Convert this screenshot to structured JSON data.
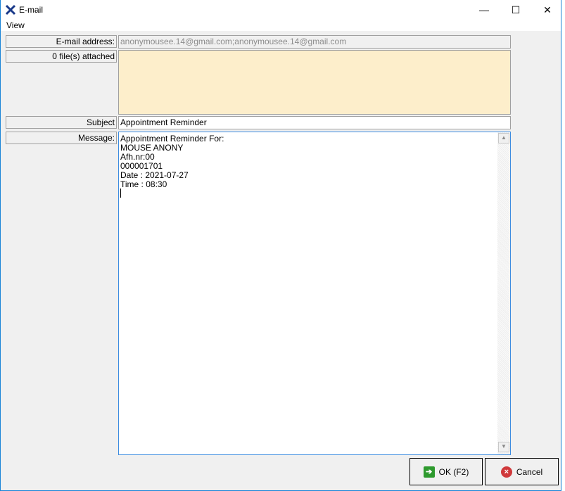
{
  "window": {
    "title": "E-mail",
    "minimize": "—",
    "maximize": "☐",
    "close": "✕"
  },
  "menu": {
    "view": "View"
  },
  "form": {
    "email_label": "E-mail address:",
    "email_value": "anonymousee.14@gmail.com;anonymousee.14@gmail.com",
    "attach_label": "0 file(s) attached",
    "subject_label": "Subject",
    "subject_value": "Appointment Reminder",
    "message_label": "Message:",
    "message_value": "Appointment Reminder For:\nMOUSE ANONY\nAfh.nr:00\n000001701\nDate : 2021-07-27\nTime : 08:30"
  },
  "buttons": {
    "ok": "OK (F2)",
    "cancel": "Cancel"
  },
  "colors": {
    "attach_bg": "#fdeecb",
    "ok_icon": "#2e9a2e",
    "cancel_icon": "#d0393b"
  }
}
